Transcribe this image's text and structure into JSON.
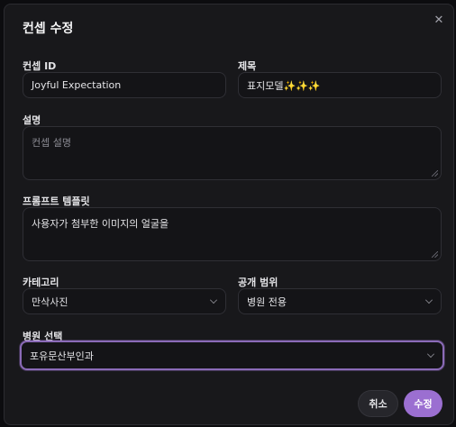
{
  "dialog": {
    "title": "컨셉 수정",
    "close_icon": "close-icon"
  },
  "form": {
    "concept_id": {
      "label": "컨셉 ID",
      "value": "Joyful Expectation"
    },
    "title": {
      "label": "제목",
      "value": "표지모델✨✨✨"
    },
    "description": {
      "label": "설명",
      "placeholder": "컨셉 설명",
      "value": ""
    },
    "prompt_template": {
      "label": "프롬프트 템플릿",
      "value": "사용자가 첨부한 이미지의 얼굴을"
    },
    "category": {
      "label": "카테고리",
      "value": "만삭사진"
    },
    "visibility": {
      "label": "공개 범위",
      "value": "병원 전용"
    },
    "hospital": {
      "label": "병원 선택",
      "value": "포유문산부인과"
    }
  },
  "actions": {
    "cancel_label": "취소",
    "submit_label": "수정"
  },
  "colors": {
    "accent": "#9b6fd1",
    "focus_ring": "#8b6bb8",
    "panel": "#18181b",
    "field": "#141417"
  }
}
